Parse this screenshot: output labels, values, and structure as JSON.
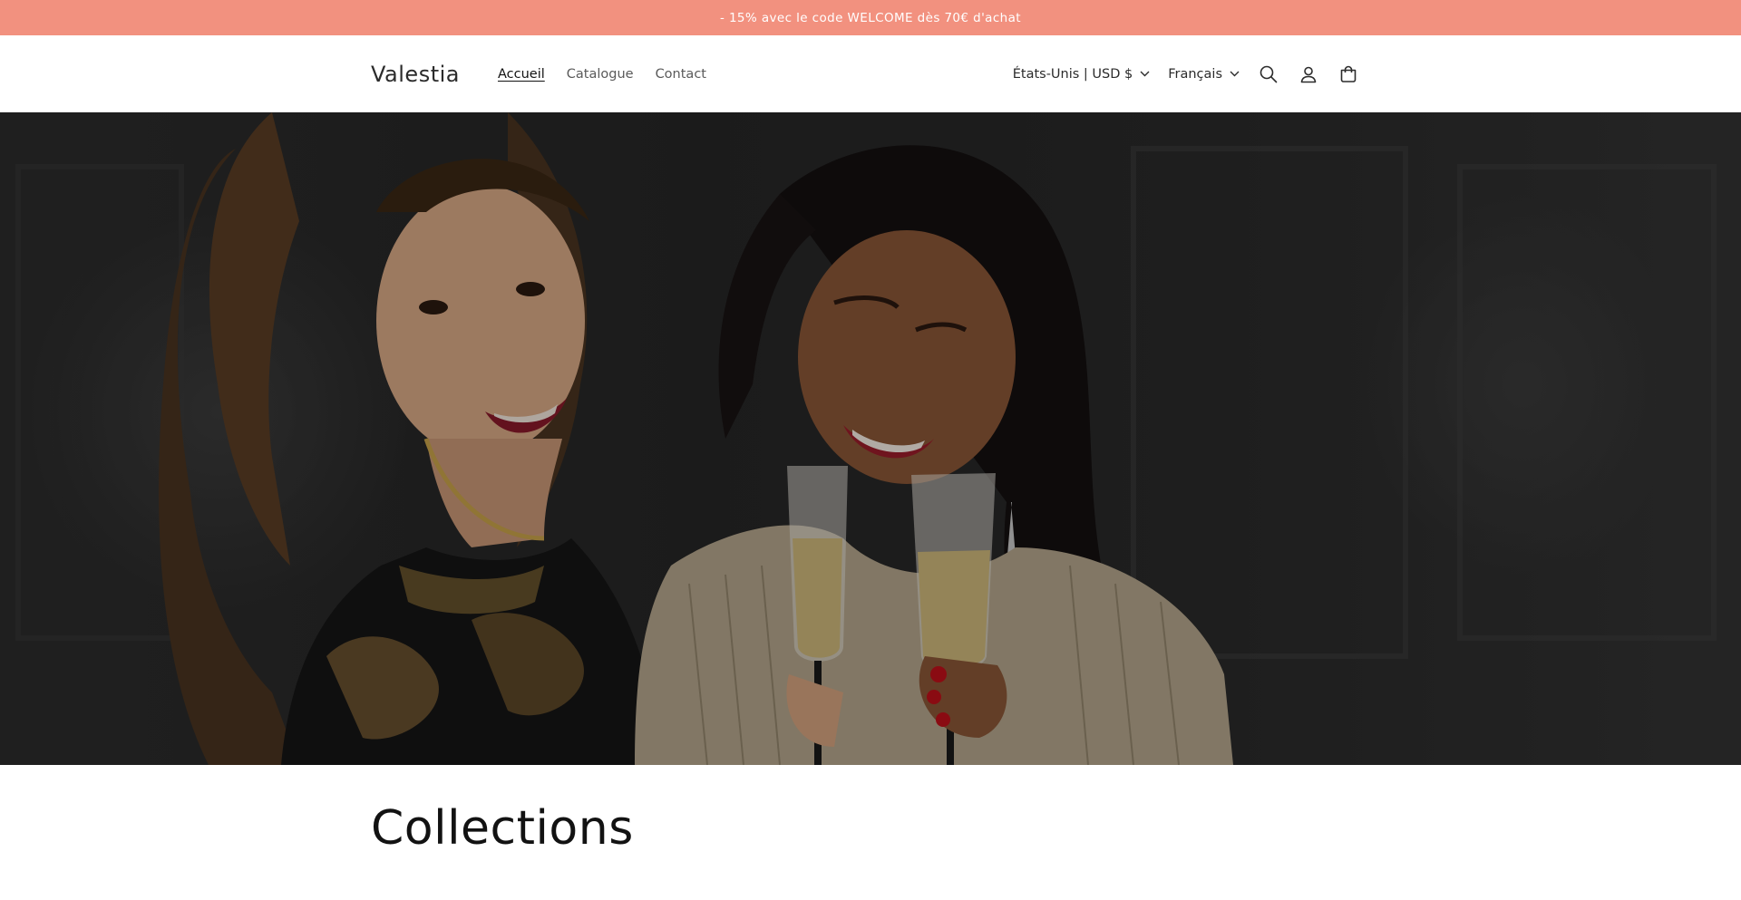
{
  "announcement": {
    "text": "- 15% avec le code WELCOME dès 70€ d'achat"
  },
  "header": {
    "logo": "Valestia",
    "nav": [
      {
        "label": "Accueil",
        "active": true
      },
      {
        "label": "Catalogue",
        "active": false
      },
      {
        "label": "Contact",
        "active": false
      }
    ],
    "country_selector": "États-Unis | USD $",
    "language_selector": "Français",
    "icons": [
      "search-icon",
      "account-icon",
      "cart-icon"
    ]
  },
  "hero": {
    "image": "two-women-toasting-champagne"
  },
  "collections": {
    "title": "Collections"
  },
  "colors": {
    "announcement_bg": "#f2917f",
    "announcement_text": "#ffffff",
    "text": "#121212",
    "nav_muted": "#5a5a5a"
  }
}
